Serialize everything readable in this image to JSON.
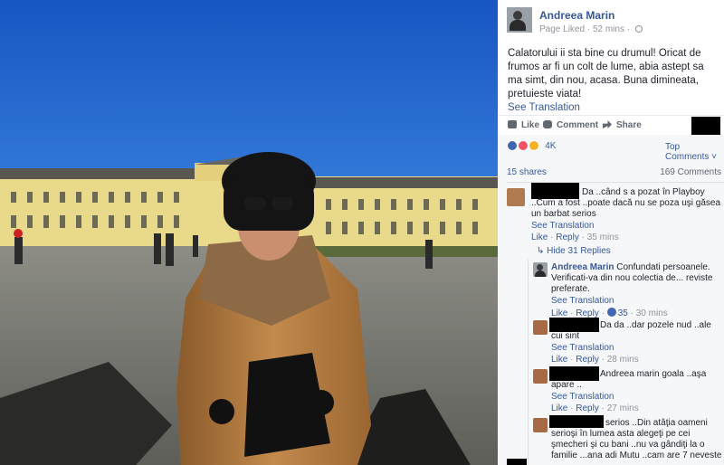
{
  "post": {
    "author": "Andreea Marin",
    "page_liked": "Page Liked",
    "time": "52 mins",
    "text": "Calatorului ii sta bine cu drumul! Oricat de frumos ar fi un colt de lume, abia astept sa ma simt, din nou, acasa. Buna dimineata, pretuieste viata!",
    "see_translation": "See Translation"
  },
  "actions": {
    "like": "Like",
    "comment": "Comment",
    "share": "Share"
  },
  "stats": {
    "reactions_count": "4K",
    "top_comments": "Top Comments ˅",
    "shares": "15 shares",
    "comments": "169 Comments"
  },
  "comments": [
    {
      "text": "Da ..când s a pozat în Playboy ..Cum a fost ..poate dacă nu se poza uşi găsea un barbat serios",
      "see_translation": "See Translation",
      "like": "Like",
      "reply": "Reply",
      "time": "35 mins"
    }
  ],
  "hide_replies": "Hide 31 Replies",
  "replies": [
    {
      "author": "Andreea Marin",
      "text": "Confundati persoanele. Verificati-va din nou colectia de... reviste preferate.",
      "see_translation": "See Translation",
      "like": "Like",
      "reply": "Reply",
      "likes": "35",
      "time": "30 mins"
    },
    {
      "text": "Da da ..dar pozele nud ..ale cui sint",
      "see_translation": "See Translation",
      "like": "Like",
      "reply": "Reply",
      "time": "28 mins"
    },
    {
      "text": "Andreea marin goala ..aşa apare ..",
      "see_translation": "See Translation",
      "like": "Like",
      "reply": "Reply",
      "time": "27 mins"
    },
    {
      "text": "serios ..Din atâţia oameni serioşi în lumea asta alegeţi pe cei şmecheri şi cu bani ..nu va gândiţi la o familie ...ana adi Mutu ..cam are 7 neveste"
    }
  ],
  "colors": {
    "sky": "#1f63c7",
    "link": "#365899",
    "panel_bg": "#ffffff",
    "comments_bg": "#f6f7f9"
  }
}
